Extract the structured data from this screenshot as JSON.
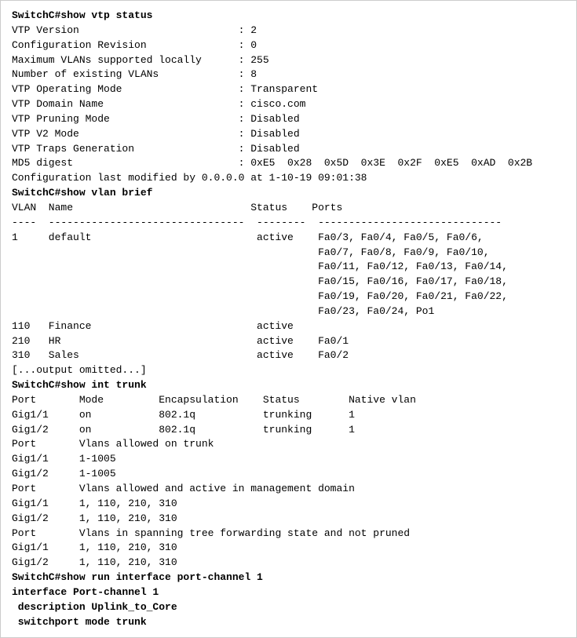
{
  "terminal": {
    "lines": [
      {
        "id": "l1",
        "text": "SwitchC#show vtp status",
        "bold": true
      },
      {
        "id": "l2",
        "text": "VTP Version                          : 2",
        "bold": false
      },
      {
        "id": "l3",
        "text": "Configuration Revision               : 0",
        "bold": false
      },
      {
        "id": "l4",
        "text": "Maximum VLANs supported locally      : 255",
        "bold": false
      },
      {
        "id": "l5",
        "text": "Number of existing VLANs             : 8",
        "bold": false
      },
      {
        "id": "l6",
        "text": "VTP Operating Mode                   : Transparent",
        "bold": false
      },
      {
        "id": "l7",
        "text": "VTP Domain Name                      : cisco.com",
        "bold": false
      },
      {
        "id": "l8",
        "text": "VTP Pruning Mode                     : Disabled",
        "bold": false
      },
      {
        "id": "l9",
        "text": "VTP V2 Mode                          : Disabled",
        "bold": false
      },
      {
        "id": "l10",
        "text": "VTP Traps Generation                 : Disabled",
        "bold": false
      },
      {
        "id": "l11",
        "text": "MD5 digest                           : 0xE5  0x28  0x5D  0x3E  0x2F  0xE5  0xAD  0x2B",
        "bold": false
      },
      {
        "id": "l12",
        "text": "Configuration last modified by 0.0.0.0 at 1-10-19 09:01:38",
        "bold": false
      },
      {
        "id": "l13",
        "text": "",
        "bold": false
      },
      {
        "id": "l14",
        "text": "SwitchC#show vlan brief",
        "bold": true
      },
      {
        "id": "l15",
        "text": "",
        "bold": false
      },
      {
        "id": "l16",
        "text": "VLAN  Name                             Status    Ports",
        "bold": false
      },
      {
        "id": "l17",
        "text": "----  --------------------------------  --------  ------------------------------",
        "bold": false
      },
      {
        "id": "l18",
        "text": "1     default                           active    Fa0/3, Fa0/4, Fa0/5, Fa0/6,",
        "bold": false
      },
      {
        "id": "l19",
        "text": "                                                  Fa0/7, Fa0/8, Fa0/9, Fa0/10,",
        "bold": false
      },
      {
        "id": "l20",
        "text": "                                                  Fa0/11, Fa0/12, Fa0/13, Fa0/14,",
        "bold": false
      },
      {
        "id": "l21",
        "text": "                                                  Fa0/15, Fa0/16, Fa0/17, Fa0/18,",
        "bold": false
      },
      {
        "id": "l22",
        "text": "                                                  Fa0/19, Fa0/20, Fa0/21, Fa0/22,",
        "bold": false
      },
      {
        "id": "l23",
        "text": "                                                  Fa0/23, Fa0/24, Po1",
        "bold": false
      },
      {
        "id": "l24",
        "text": "110   Finance                           active",
        "bold": false
      },
      {
        "id": "l25",
        "text": "210   HR                                active    Fa0/1",
        "bold": false
      },
      {
        "id": "l26",
        "text": "310   Sales                             active    Fa0/2",
        "bold": false
      },
      {
        "id": "l27",
        "text": "[...output omitted...]",
        "bold": false
      },
      {
        "id": "l28",
        "text": "",
        "bold": false
      },
      {
        "id": "l29",
        "text": "SwitchC#show int trunk",
        "bold": true
      },
      {
        "id": "l30",
        "text": "Port       Mode         Encapsulation    Status        Native vlan",
        "bold": false
      },
      {
        "id": "l31",
        "text": "Gig1/1     on           802.1q           trunking      1",
        "bold": false
      },
      {
        "id": "l32",
        "text": "Gig1/2     on           802.1q           trunking      1",
        "bold": false
      },
      {
        "id": "l33",
        "text": "",
        "bold": false
      },
      {
        "id": "l34",
        "text": "Port       Vlans allowed on trunk",
        "bold": false
      },
      {
        "id": "l35",
        "text": "Gig1/1     1-1005",
        "bold": false
      },
      {
        "id": "l36",
        "text": "Gig1/2     1-1005",
        "bold": false
      },
      {
        "id": "l37",
        "text": "",
        "bold": false
      },
      {
        "id": "l38",
        "text": "Port       Vlans allowed and active in management domain",
        "bold": false
      },
      {
        "id": "l39",
        "text": "Gig1/1     1, 110, 210, 310",
        "bold": false
      },
      {
        "id": "l40",
        "text": "Gig1/2     1, 110, 210, 310",
        "bold": false
      },
      {
        "id": "l41",
        "text": "",
        "bold": false
      },
      {
        "id": "l42",
        "text": "Port       Vlans in spanning tree forwarding state and not pruned",
        "bold": false
      },
      {
        "id": "l43",
        "text": "Gig1/1     1, 110, 210, 310",
        "bold": false
      },
      {
        "id": "l44",
        "text": "Gig1/2     1, 110, 210, 310",
        "bold": false
      },
      {
        "id": "l45",
        "text": "",
        "bold": false
      },
      {
        "id": "l46",
        "text": "SwitchC#show run interface port-channel 1",
        "bold": true
      },
      {
        "id": "l47",
        "text": "interface Port-channel 1",
        "bold": true
      },
      {
        "id": "l48",
        "text": " description Uplink_to_Core",
        "bold": true
      },
      {
        "id": "l49",
        "text": " switchport mode trunk",
        "bold": true
      }
    ]
  }
}
